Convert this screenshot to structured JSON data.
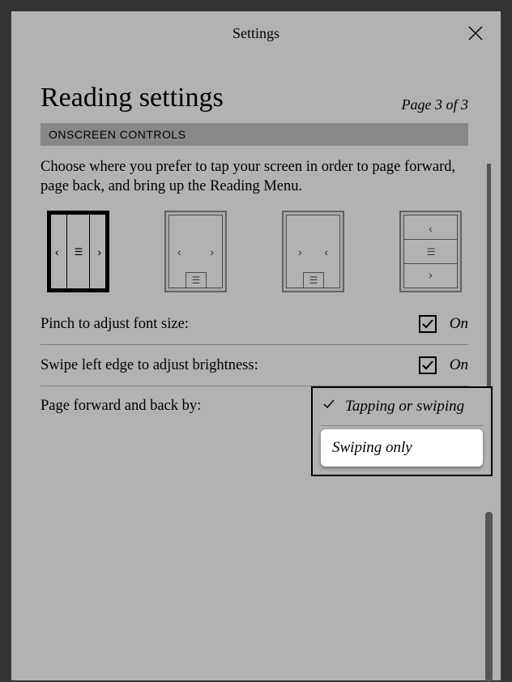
{
  "modal": {
    "title": "Settings"
  },
  "page": {
    "heading": "Reading settings",
    "page_indicator": "Page 3 of 3"
  },
  "section": {
    "title": "ONSCREEN CONTROLS",
    "description": "Choose where you prefer to tap your screen in order to page forward, page back, and bring up the Reading Menu."
  },
  "settings": {
    "pinch": {
      "label": "Pinch to adjust font size:",
      "state": "On",
      "checked": true
    },
    "swipe_brightness": {
      "label": "Swipe left edge to adjust brightness:",
      "state": "On",
      "checked": true
    },
    "page_nav": {
      "label": "Page forward and back by:"
    }
  },
  "dropdown": {
    "options": [
      {
        "label": "Tapping or swiping",
        "selected": true
      },
      {
        "label": "Swiping only",
        "selected": false,
        "highlight": true
      }
    ]
  }
}
